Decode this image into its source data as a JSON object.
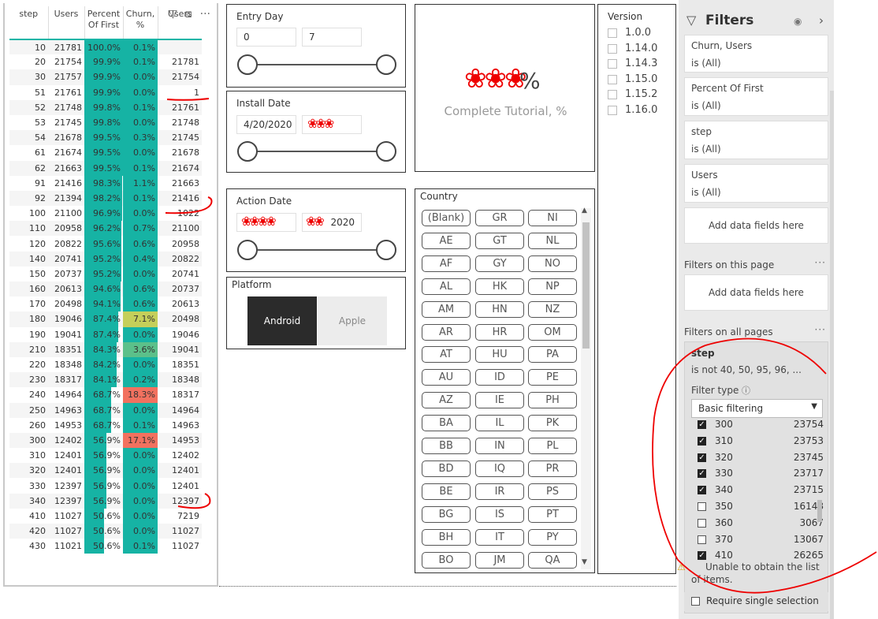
{
  "table": {
    "headers": [
      "step",
      "Users",
      "Percent Of First",
      "Churn, %",
      "Users"
    ],
    "rows": [
      {
        "step": "10",
        "users": "21781",
        "pct": "100.0%",
        "pct_fraction": 1.0,
        "churn": "0.1%",
        "churn_fraction": 0.001,
        "prev": ""
      },
      {
        "step": "20",
        "users": "21754",
        "pct": "99.9%",
        "pct_fraction": 0.999,
        "churn": "0.1%",
        "churn_fraction": 0.001,
        "prev": "21781"
      },
      {
        "step": "30",
        "users": "21757",
        "pct": "99.9%",
        "pct_fraction": 0.999,
        "churn": "0.0%",
        "churn_fraction": 0.0,
        "prev": "21754"
      },
      {
        "step": "51",
        "users": "21761",
        "pct": "99.9%",
        "pct_fraction": 0.999,
        "churn": "0.0%",
        "churn_fraction": 0.0,
        "prev": "1"
      },
      {
        "step": "52",
        "users": "21748",
        "pct": "99.8%",
        "pct_fraction": 0.998,
        "churn": "0.1%",
        "churn_fraction": 0.001,
        "prev": "21761"
      },
      {
        "step": "53",
        "users": "21745",
        "pct": "99.8%",
        "pct_fraction": 0.998,
        "churn": "0.0%",
        "churn_fraction": 0.0,
        "prev": "21748"
      },
      {
        "step": "54",
        "users": "21678",
        "pct": "99.5%",
        "pct_fraction": 0.995,
        "churn": "0.3%",
        "churn_fraction": 0.003,
        "prev": "21745"
      },
      {
        "step": "61",
        "users": "21674",
        "pct": "99.5%",
        "pct_fraction": 0.995,
        "churn": "0.0%",
        "churn_fraction": 0.0,
        "prev": "21678"
      },
      {
        "step": "62",
        "users": "21663",
        "pct": "99.5%",
        "pct_fraction": 0.995,
        "churn": "0.1%",
        "churn_fraction": 0.001,
        "prev": "21674"
      },
      {
        "step": "91",
        "users": "21416",
        "pct": "98.3%",
        "pct_fraction": 0.983,
        "churn": "1.1%",
        "churn_fraction": 0.011,
        "prev": "21663"
      },
      {
        "step": "92",
        "users": "21394",
        "pct": "98.2%",
        "pct_fraction": 0.982,
        "churn": "0.1%",
        "churn_fraction": 0.001,
        "prev": "21416"
      },
      {
        "step": "100",
        "users": "21100",
        "pct": "96.9%",
        "pct_fraction": 0.969,
        "churn": "0.0%",
        "churn_fraction": 0.0,
        "prev": "1022"
      },
      {
        "step": "110",
        "users": "20958",
        "pct": "96.2%",
        "pct_fraction": 0.962,
        "churn": "0.7%",
        "churn_fraction": 0.007,
        "prev": "21100"
      },
      {
        "step": "120",
        "users": "20822",
        "pct": "95.6%",
        "pct_fraction": 0.956,
        "churn": "0.6%",
        "churn_fraction": 0.006,
        "prev": "20958"
      },
      {
        "step": "140",
        "users": "20741",
        "pct": "95.2%",
        "pct_fraction": 0.952,
        "churn": "0.4%",
        "churn_fraction": 0.004,
        "prev": "20822"
      },
      {
        "step": "150",
        "users": "20737",
        "pct": "95.2%",
        "pct_fraction": 0.952,
        "churn": "0.0%",
        "churn_fraction": 0.0,
        "prev": "20741"
      },
      {
        "step": "160",
        "users": "20613",
        "pct": "94.6%",
        "pct_fraction": 0.946,
        "churn": "0.6%",
        "churn_fraction": 0.006,
        "prev": "20737"
      },
      {
        "step": "170",
        "users": "20498",
        "pct": "94.1%",
        "pct_fraction": 0.941,
        "churn": "0.6%",
        "churn_fraction": 0.006,
        "prev": "20613"
      },
      {
        "step": "180",
        "users": "19046",
        "pct": "87.4%",
        "pct_fraction": 0.874,
        "churn": "7.1%",
        "churn_fraction": 0.071,
        "prev": "20498"
      },
      {
        "step": "190",
        "users": "19041",
        "pct": "87.4%",
        "pct_fraction": 0.874,
        "churn": "0.0%",
        "churn_fraction": 0.0,
        "prev": "19046"
      },
      {
        "step": "210",
        "users": "18351",
        "pct": "84.3%",
        "pct_fraction": 0.843,
        "churn": "3.6%",
        "churn_fraction": 0.036,
        "prev": "19041"
      },
      {
        "step": "220",
        "users": "18348",
        "pct": "84.2%",
        "pct_fraction": 0.842,
        "churn": "0.0%",
        "churn_fraction": 0.0,
        "prev": "18351"
      },
      {
        "step": "230",
        "users": "18317",
        "pct": "84.1%",
        "pct_fraction": 0.841,
        "churn": "0.2%",
        "churn_fraction": 0.002,
        "prev": "18348"
      },
      {
        "step": "240",
        "users": "14964",
        "pct": "68.7%",
        "pct_fraction": 0.687,
        "churn": "18.3%",
        "churn_fraction": 0.183,
        "prev": "18317"
      },
      {
        "step": "250",
        "users": "14963",
        "pct": "68.7%",
        "pct_fraction": 0.687,
        "churn": "0.0%",
        "churn_fraction": 0.0,
        "prev": "14964"
      },
      {
        "step": "260",
        "users": "14953",
        "pct": "68.7%",
        "pct_fraction": 0.687,
        "churn": "0.1%",
        "churn_fraction": 0.001,
        "prev": "14963"
      },
      {
        "step": "300",
        "users": "12402",
        "pct": "56.9%",
        "pct_fraction": 0.569,
        "churn": "17.1%",
        "churn_fraction": 0.171,
        "prev": "14953"
      },
      {
        "step": "310",
        "users": "12401",
        "pct": "56.9%",
        "pct_fraction": 0.569,
        "churn": "0.0%",
        "churn_fraction": 0.0,
        "prev": "12402"
      },
      {
        "step": "320",
        "users": "12401",
        "pct": "56.9%",
        "pct_fraction": 0.569,
        "churn": "0.0%",
        "churn_fraction": 0.0,
        "prev": "12401"
      },
      {
        "step": "330",
        "users": "12397",
        "pct": "56.9%",
        "pct_fraction": 0.569,
        "churn": "0.0%",
        "churn_fraction": 0.0,
        "prev": "12401"
      },
      {
        "step": "340",
        "users": "12397",
        "pct": "56.9%",
        "pct_fraction": 0.569,
        "churn": "0.0%",
        "churn_fraction": 0.0,
        "prev": "12397"
      },
      {
        "step": "410",
        "users": "11027",
        "pct": "50.6%",
        "pct_fraction": 0.506,
        "churn": "0.0%",
        "churn_fraction": 0.0,
        "prev": "7219"
      },
      {
        "step": "420",
        "users": "11027",
        "pct": "50.6%",
        "pct_fraction": 0.506,
        "churn": "0.0%",
        "churn_fraction": 0.0,
        "prev": "11027"
      },
      {
        "step": "430",
        "users": "11021",
        "pct": "50.6%",
        "pct_fraction": 0.506,
        "churn": "0.1%",
        "churn_fraction": 0.001,
        "prev": "11027"
      }
    ],
    "colors": {
      "bar": "#16b3a4",
      "churn_low": "#16b3a4",
      "churn_mid": "#5cc08a",
      "churn_warn": "#c5cf5a",
      "churn_high": "#f2715f"
    }
  },
  "entry_day": {
    "title": "Entry Day",
    "from": "0",
    "to": "7"
  },
  "install_date": {
    "title": "Install Date",
    "from": "4/20/2020"
  },
  "action_date": {
    "title": "Action Date",
    "to_suffix": "2020"
  },
  "platform": {
    "title": "Platform",
    "options": [
      "Android",
      "Apple"
    ],
    "selected": "Android"
  },
  "kpi": {
    "label": "Complete Tutorial, %",
    "value_suffix": "%"
  },
  "version": {
    "title": "Version",
    "items": [
      "1.0.0",
      "1.14.0",
      "1.14.3",
      "1.15.0",
      "1.15.2",
      "1.16.0"
    ]
  },
  "country": {
    "title": "Country",
    "items": [
      "(Blank)",
      "GR",
      "NI",
      "AE",
      "GT",
      "NL",
      "AF",
      "GY",
      "NO",
      "AL",
      "HK",
      "NP",
      "AM",
      "HN",
      "NZ",
      "AR",
      "HR",
      "OM",
      "AT",
      "HU",
      "PA",
      "AU",
      "ID",
      "PE",
      "AZ",
      "IE",
      "PH",
      "BA",
      "IL",
      "PK",
      "BB",
      "IN",
      "PL",
      "BD",
      "IQ",
      "PR",
      "BE",
      "IR",
      "PS",
      "BG",
      "IS",
      "PT",
      "BH",
      "IT",
      "PY",
      "BO",
      "JM",
      "QA"
    ]
  },
  "filters": {
    "title": "Filters",
    "visual_cards": [
      {
        "name": "Churn, Users",
        "value": "is (All)"
      },
      {
        "name": "Percent Of First",
        "value": "is (All)"
      },
      {
        "name": "step",
        "value": "is (All)"
      },
      {
        "name": "Users",
        "value": "is (All)"
      }
    ],
    "add_fields": "Add data fields here",
    "this_page": "Filters on this page",
    "all_pages": "Filters on all pages",
    "step_filter": {
      "name": "step",
      "summary": "is not 40, 50, 95, 96, ...",
      "filter_type_label": "Filter type",
      "filter_type": "Basic filtering",
      "items": [
        {
          "v": "300",
          "c": "23754",
          "checked": true
        },
        {
          "v": "310",
          "c": "23753",
          "checked": true
        },
        {
          "v": "320",
          "c": "23745",
          "checked": true
        },
        {
          "v": "330",
          "c": "23717",
          "checked": true
        },
        {
          "v": "340",
          "c": "23715",
          "checked": true
        },
        {
          "v": "350",
          "c": "16148",
          "checked": false
        },
        {
          "v": "360",
          "c": "3067",
          "checked": false
        },
        {
          "v": "370",
          "c": "13067",
          "checked": false
        },
        {
          "v": "410",
          "c": "26265",
          "checked": true
        }
      ],
      "warning": "Unable to obtain the list of items.",
      "require_single": "Require single selection"
    }
  }
}
